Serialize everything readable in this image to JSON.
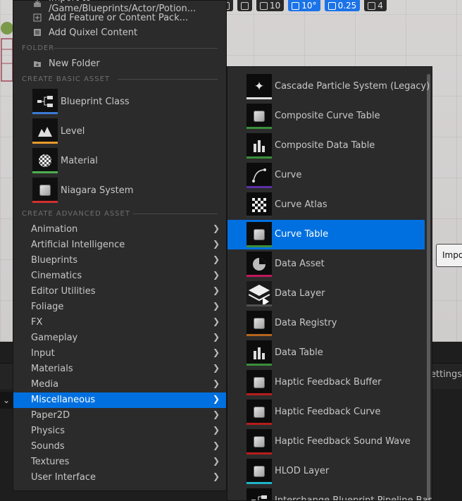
{
  "toolbar": {
    "grid_snap": "10",
    "rotation_snap": "10°",
    "scale_snap": "0.25",
    "camera_speed": "4"
  },
  "tooltip": {
    "text": "Impo"
  },
  "lower_panel": {
    "settings_text": "ettings"
  },
  "left_menu": {
    "top_items": [
      {
        "label": "Import to /Game/Blueprints/Actor/Potion...",
        "icon": "import-icon"
      },
      {
        "label": "Add Feature or Content Pack...",
        "icon": "content-pack-icon"
      },
      {
        "label": "Add Quixel Content",
        "icon": "quixel-icon"
      }
    ],
    "folder_header": "FOLDER",
    "new_folder": "New Folder",
    "basic_header": "CREATE BASIC ASSET",
    "basic_assets": [
      {
        "label": "Blueprint Class",
        "icon": "blueprint-icon",
        "color": "#3a7bd5"
      },
      {
        "label": "Level",
        "icon": "level-icon",
        "color": "#e89a2c"
      },
      {
        "label": "Material",
        "icon": "material-icon",
        "color": "#4caf50"
      },
      {
        "label": "Niagara System",
        "icon": "niagara-icon",
        "color": "#d32f2f"
      }
    ],
    "advanced_header": "CREATE ADVANCED ASSET",
    "categories": [
      "Animation",
      "Artificial Intelligence",
      "Blueprints",
      "Cinematics",
      "Editor Utilities",
      "Foliage",
      "FX",
      "Gameplay",
      "Input",
      "Materials",
      "Media",
      "Miscellaneous",
      "Paper2D",
      "Physics",
      "Sounds",
      "Textures",
      "User Interface"
    ],
    "selected_category": "Miscellaneous"
  },
  "submenu": {
    "items": [
      {
        "label": "Cascade Particle System (Legacy)",
        "icon": "particle-icon",
        "color": "#e0e0e0"
      },
      {
        "label": "Composite Curve Table",
        "icon": "curve-table-icon",
        "color": "#3a8f3a"
      },
      {
        "label": "Composite Data Table",
        "icon": "data-table-icon",
        "color": "#3a8f3a"
      },
      {
        "label": "Curve",
        "icon": "curve-icon",
        "color": "#5b2fa8"
      },
      {
        "label": "Curve Atlas",
        "icon": "checker-icon",
        "color": "#303030"
      },
      {
        "label": "Curve Table",
        "icon": "curve-table-icon",
        "color": "#3a8f3a"
      },
      {
        "label": "Data Asset",
        "icon": "pie-icon",
        "color": "#c2185b"
      },
      {
        "label": "Data Layer",
        "icon": "layers-icon",
        "color": "#505050"
      },
      {
        "label": "Data Registry",
        "icon": "registry-icon",
        "color": "#b5651d"
      },
      {
        "label": "Data Table",
        "icon": "data-table-icon",
        "color": "#3a8f3a"
      },
      {
        "label": "Haptic Feedback Buffer",
        "icon": "haptic-icon",
        "color": "#b71c1c"
      },
      {
        "label": "Haptic Feedback Curve",
        "icon": "haptic-icon",
        "color": "#b71c1c"
      },
      {
        "label": "Haptic Feedback Sound Wave",
        "icon": "haptic-icon",
        "color": "#b71c1c"
      },
      {
        "label": "HLOD Layer",
        "icon": "hlod-icon",
        "color": "#1fb5c9"
      },
      {
        "label": "Interchange Blueprint Pipeline Base",
        "icon": "pipeline-icon",
        "color": "#3a7bd5"
      }
    ],
    "selected": "Curve Table"
  }
}
